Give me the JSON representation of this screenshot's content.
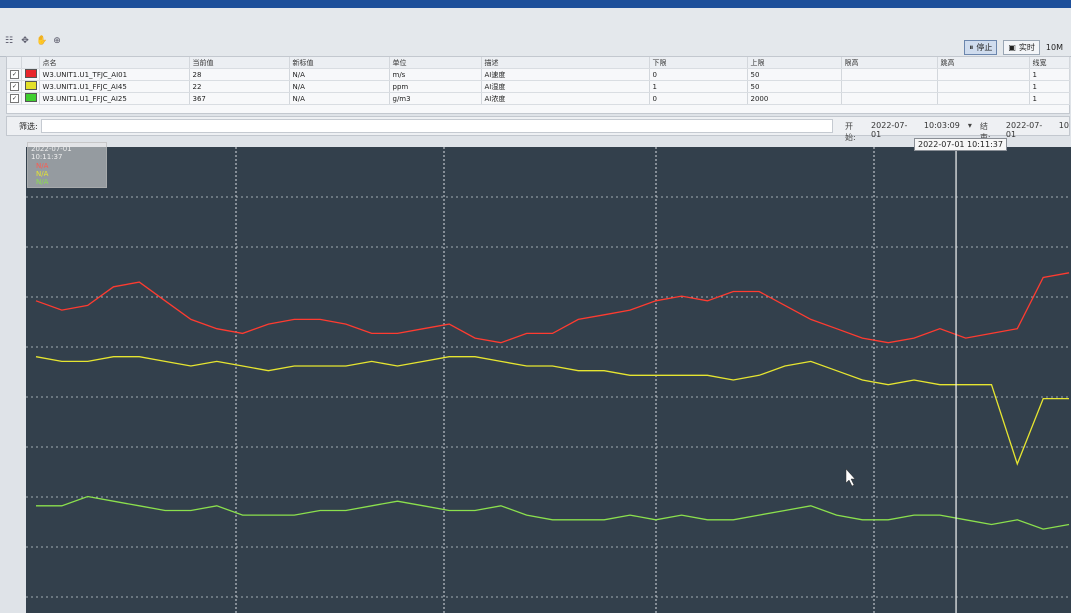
{
  "toolbar": {
    "pause_label": "停止",
    "realtime_label": "实时",
    "interval_label": "10M"
  },
  "table": {
    "headers": [
      "点名",
      "当前值",
      "新标值",
      "单位",
      "描述",
      "下限",
      "上限",
      "限高",
      "跳高",
      "线宽"
    ],
    "rows": [
      {
        "color": "#e8262b",
        "name": "W3.UNIT1.U1_TFJC_AI01",
        "current": "28",
        "new": "N/A",
        "unit": "m/s",
        "desc": "AI速度",
        "low": "0",
        "high": "50",
        "limit_high": "",
        "jump": "",
        "width": "1"
      },
      {
        "color": "#e3e029",
        "name": "W3.UNIT1.U1_FFJC_AI45",
        "current": "22",
        "new": "N/A",
        "unit": "ppm",
        "desc": "AI湿度",
        "low": "1",
        "high": "50",
        "limit_high": "",
        "jump": "",
        "width": "1"
      },
      {
        "color": "#3fcf2f",
        "name": "W3.UNIT1.U1_FFJC_AI25",
        "current": "367",
        "new": "N/A",
        "unit": "g/m3",
        "desc": "AI浓度",
        "low": "0",
        "high": "2000",
        "limit_high": "",
        "jump": "",
        "width": "1"
      }
    ]
  },
  "filter": {
    "label": "筛选:",
    "start_label": "开始:",
    "start_date": "2022-07-01",
    "start_time": "10:03:09",
    "end_label": "结束:",
    "end_date": "2022-07-01",
    "end_extra": "10"
  },
  "cursor": {
    "time": "2022-07-01 10:11:37"
  },
  "legend": {
    "timestamp": "2022-07-01 10:11:37",
    "entries": [
      "N/A",
      "N/A",
      "N/A"
    ]
  },
  "chart_data": {
    "type": "line",
    "background": "#33404c",
    "grid": true,
    "series": [
      {
        "color": "#ff3b30",
        "values": [
          0.67,
          0.65,
          0.66,
          0.7,
          0.71,
          0.67,
          0.63,
          0.61,
          0.6,
          0.62,
          0.63,
          0.63,
          0.62,
          0.6,
          0.6,
          0.61,
          0.62,
          0.59,
          0.58,
          0.6,
          0.6,
          0.63,
          0.64,
          0.65,
          0.67,
          0.68,
          0.67,
          0.69,
          0.69,
          0.66,
          0.63,
          0.61,
          0.59,
          0.58,
          0.59,
          0.61,
          0.59,
          0.6,
          0.61,
          0.72,
          0.73
        ]
      },
      {
        "color": "#e6e530",
        "values": [
          0.55,
          0.54,
          0.54,
          0.55,
          0.55,
          0.54,
          0.53,
          0.54,
          0.53,
          0.52,
          0.53,
          0.53,
          0.53,
          0.54,
          0.53,
          0.54,
          0.55,
          0.55,
          0.54,
          0.53,
          0.53,
          0.52,
          0.52,
          0.51,
          0.51,
          0.51,
          0.51,
          0.5,
          0.51,
          0.53,
          0.54,
          0.52,
          0.5,
          0.49,
          0.5,
          0.49,
          0.49,
          0.49,
          0.32,
          0.46,
          0.46
        ]
      },
      {
        "color": "#8be04d",
        "values": [
          0.23,
          0.23,
          0.25,
          0.24,
          0.23,
          0.22,
          0.22,
          0.23,
          0.21,
          0.21,
          0.21,
          0.22,
          0.22,
          0.23,
          0.24,
          0.23,
          0.22,
          0.22,
          0.23,
          0.21,
          0.2,
          0.2,
          0.2,
          0.21,
          0.2,
          0.21,
          0.2,
          0.2,
          0.21,
          0.22,
          0.23,
          0.21,
          0.2,
          0.2,
          0.21,
          0.21,
          0.2,
          0.19,
          0.2,
          0.18,
          0.19
        ]
      }
    ],
    "cursor_fraction": 0.89
  }
}
